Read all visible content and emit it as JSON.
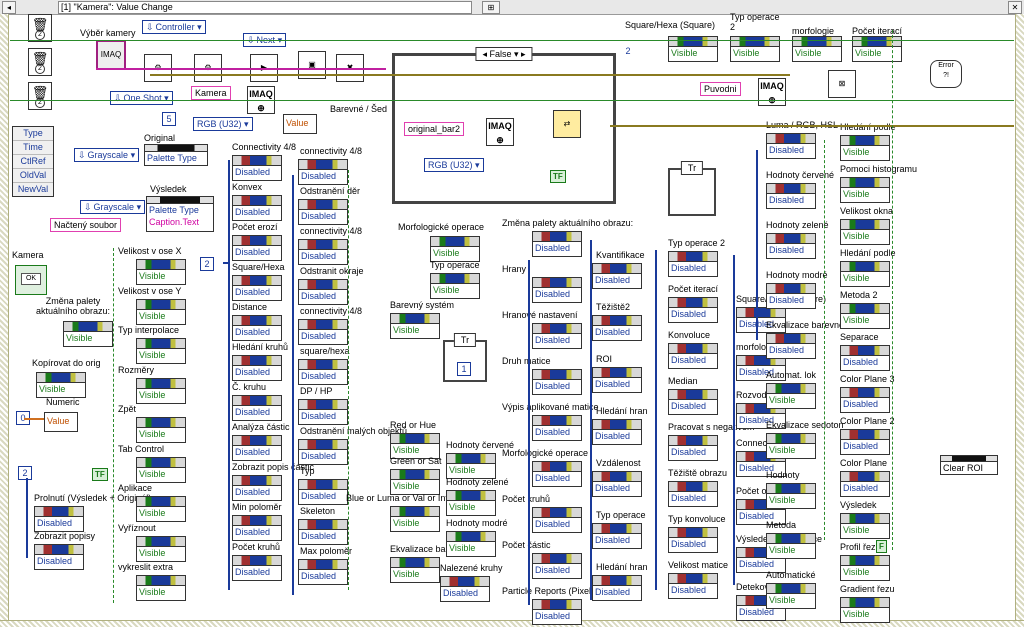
{
  "header": {
    "event_selector": "[1] \"Kamera\": Value Change"
  },
  "event_node": [
    "Type",
    "Time",
    "CtlRef",
    "OldVal",
    "NewVal"
  ],
  "top_row": {
    "vyber_kamery": "Výběr kamery",
    "controller": "Controller",
    "one_shot": "One Shot",
    "next": "Next",
    "kamera": "Kamera",
    "rgb": "RGB (U32)",
    "num5": "5",
    "value": "Value",
    "barevne": "Barevné / Šed",
    "case_false": "False",
    "original_bar2": "original_bar2",
    "rgb2": "RGB (U32)",
    "true_c": "TF",
    "puvodni": "Puvodni",
    "imaq": "IMAQ",
    "error": "Error ?!"
  },
  "left_col": {
    "original": "Original",
    "grayscale1": "Grayscale",
    "palette_type1": "Palette Type",
    "vysledek": "Výsledek",
    "grayscale2": "Grayscale",
    "palette_type2": "Palette Type",
    "nacteny": "Načtený soubor",
    "caption": "Caption.Text",
    "kamera_btn": "Kamera",
    "ok": "OK",
    "zmena_palety": "Změna palety aktuálního obrazu:",
    "kopirovat": "Kopírovat do orig",
    "numeric": "Numeric",
    "num0": "0",
    "value": "Value",
    "num2": "2",
    "tf": "TF",
    "prolnuti": "Prolnutí (Výsledek + Originál)",
    "zobrazit_popisy": "Zobrazit popisy",
    "visible": "Visible",
    "disabled": "Disabled"
  },
  "col2": [
    "Velikost v ose X",
    "Velikost v ose Y",
    "Typ interpolace",
    "Rozměry",
    "Zpět",
    "Tab Control",
    "Aplikace",
    "Vyříznout",
    "vykreslit extra"
  ],
  "col3": [
    "Connectivity 4/8",
    "Konvex",
    "Počet erozí",
    "Square/Hexa",
    "Distance",
    "Hledání kruhů",
    "Č. kruhu",
    "Analýza částic",
    "Zobrazit popis částic",
    "Min poloměr",
    "Počet kruhů"
  ],
  "col4": [
    "connectivity 4/8",
    "Odstranění děr",
    "connectivity 4/8",
    "Odstranit okraje",
    "connectivity 4/8",
    "square/hexa",
    "DP / HP",
    "Odstranění malých objektů",
    "Typ",
    "Skeleton",
    "Max poloměr"
  ],
  "col5": {
    "morf_op": "Morfologické operace",
    "typ_op": "Typ operace",
    "barevny_system": "Barevný systém",
    "red_or_hue": "Red or Hue",
    "green_or_sat": "Green or Sat",
    "blue_or_luma": "Blue or Luma or Val or Inten",
    "ekvalizace": "Ekvalizace barevné",
    "hodnoty_cervene": "Hodnoty červené",
    "hodnoty_zelene": "Hodnoty zelené",
    "hodnoty_modre": "Hodnoty modré",
    "nalezene": "Nalezené kruhy",
    "tf_case": "Tr",
    "num1": "1",
    "num2": "2"
  },
  "col6": [
    "Změna palety aktuálního obrazu:",
    "Hrany",
    "Hranové nastavení",
    "Druh matice",
    "Výpis aplikované matice",
    "Morfologické operace",
    "Počet kruhů",
    "Počet částic",
    "Particle Reports (Pixels)"
  ],
  "col7": [
    "Kvantifikace",
    "Těžiště2",
    "ROI",
    "Hledání hran",
    "Vzdálenost",
    "Typ operace",
    "Hledání hran"
  ],
  "col8": [
    "Typ operace 2",
    "Počet iterací",
    "Konvoluce",
    "Median",
    "Pracovat s negativem",
    "Těžiště obrazu",
    "Typ konvoluce",
    "Velikost matice"
  ],
  "col9": [
    "Square/Hexa (Square)",
    "morfologie",
    "Rozvodí",
    "Connectivity 4/8",
    "Počet oblastí",
    "Výsledek kvantifikace",
    "Detekovaných hran:"
  ],
  "col10": [
    "Luma / RGB, HSL",
    "Hodnoty červené",
    "Hodnoty zelené",
    "Hodnoty modré",
    "Ekvalizace barevné",
    "Automat. lok",
    "Ekvalizace sedoton",
    "Hodnoty",
    "Metoda",
    "Automatické"
  ],
  "col11": [
    "Hledání podle",
    "Pomoci histogramu",
    "Velikost okna",
    "Hledání podle",
    "Metoda 2",
    "Separace",
    "Color Plane 3",
    "Color Plane 2",
    "Color Plane",
    "Výsledek",
    "Profil řezu",
    "Gradient řezu"
  ],
  "top_right": [
    "Square/Hexa (Square)",
    "Typ operace 2",
    "morfologie",
    "Počet iterací"
  ],
  "clear_roi": "Clear ROI",
  "num_2top": "2",
  "tr2": "Tr",
  "f_const": "F",
  "lbl_visible": "Visible",
  "lbl_disabled": "Disabled"
}
